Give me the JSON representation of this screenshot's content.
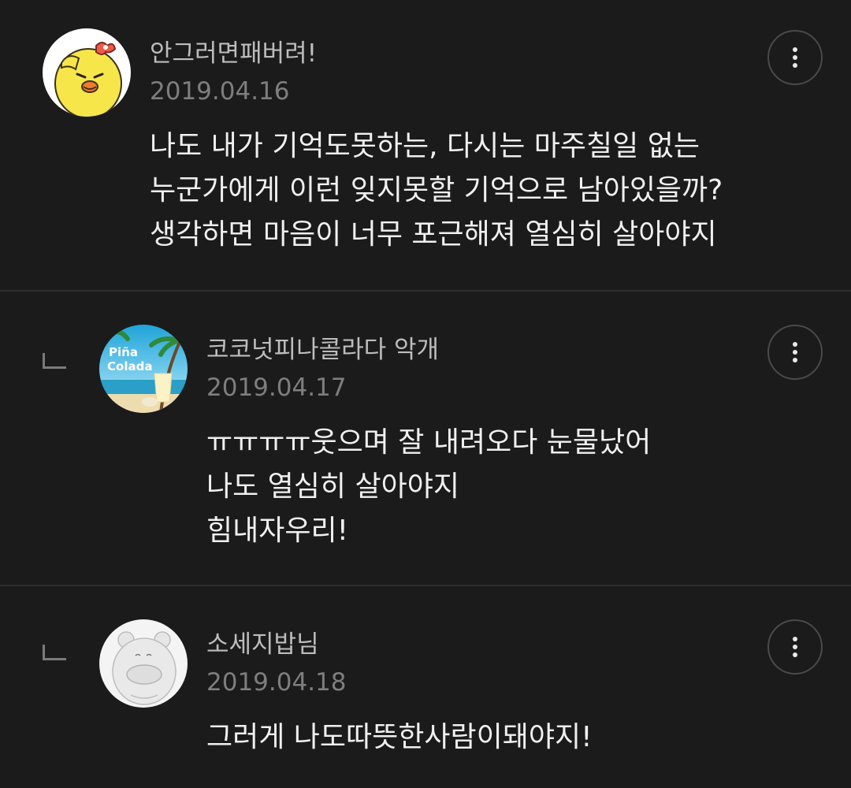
{
  "comments": [
    {
      "author": "안그러면패버려!",
      "date": "2019.04.16",
      "avatar_icon": "yellow-character-avatar",
      "lines": [
        "나도 내가 기억도못하는, 다시는 마주칠일 없는",
        "누군가에게 이런 잊지못할 기억으로 남아있을까?",
        "생각하면 마음이 너무 포근해져 열심히 살아야지"
      ]
    },
    {
      "author": "코코넛피나콜라다 악개",
      "date": "2019.04.17",
      "avatar_icon": "pina-colada-avatar",
      "avatar_text": [
        "Piña",
        "Colada"
      ],
      "lines": [
        "ㅠㅠㅠㅠ웃으며 잘 내려오다 눈물났어",
        "나도 열심히 살아야지",
        "힘내자우리!"
      ]
    },
    {
      "author": "소세지밥님",
      "date": "2019.04.18",
      "avatar_icon": "bear-character-avatar",
      "lines": [
        "그러게 나도따뜻한사람이돼야지!"
      ]
    }
  ],
  "colors": {
    "background": "#1b1b1b",
    "divider": "#2e2e2e",
    "author": "#bdbdbd",
    "date": "#7e7e7e",
    "text": "#f0f0f0"
  },
  "icons": {
    "more": "more-vertical-icon",
    "reply": "reply-indicator-icon"
  }
}
